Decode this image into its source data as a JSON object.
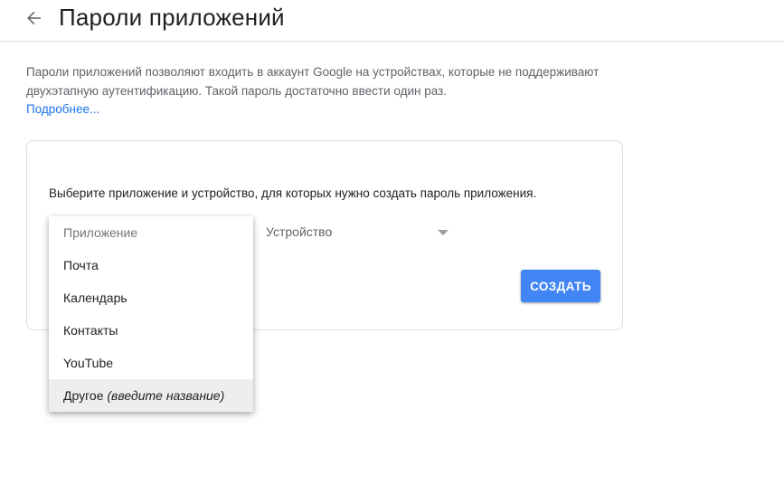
{
  "header": {
    "title": "Пароли приложений",
    "back_icon": "arrow-back-icon"
  },
  "intro": {
    "text": "Пароли приложений позволяют входить в аккаунт Google на устройствах, которые не поддерживают двухэтапную аутентификацию. Такой пароль достаточно ввести один раз.",
    "link": "Подробнее..."
  },
  "card": {
    "instruction": "Выберите приложение и устройство, для которых нужно создать пароль приложения.",
    "app_select": {
      "placeholder": "Приложение",
      "options": [
        {
          "label": "Почта"
        },
        {
          "label": "Календарь"
        },
        {
          "label": "Контакты"
        },
        {
          "label": "YouTube"
        },
        {
          "label": "Другое",
          "hint": "(введите название)"
        }
      ]
    },
    "device_select": {
      "placeholder": "Устройство",
      "arrow_icon": "dropdown-arrow-icon"
    },
    "create_button": "СОЗДАТЬ"
  },
  "colors": {
    "primary_button": "#4285f4",
    "link": "#1a73e8",
    "hover_bg": "#eeeeee",
    "divider": "#dadce0"
  }
}
